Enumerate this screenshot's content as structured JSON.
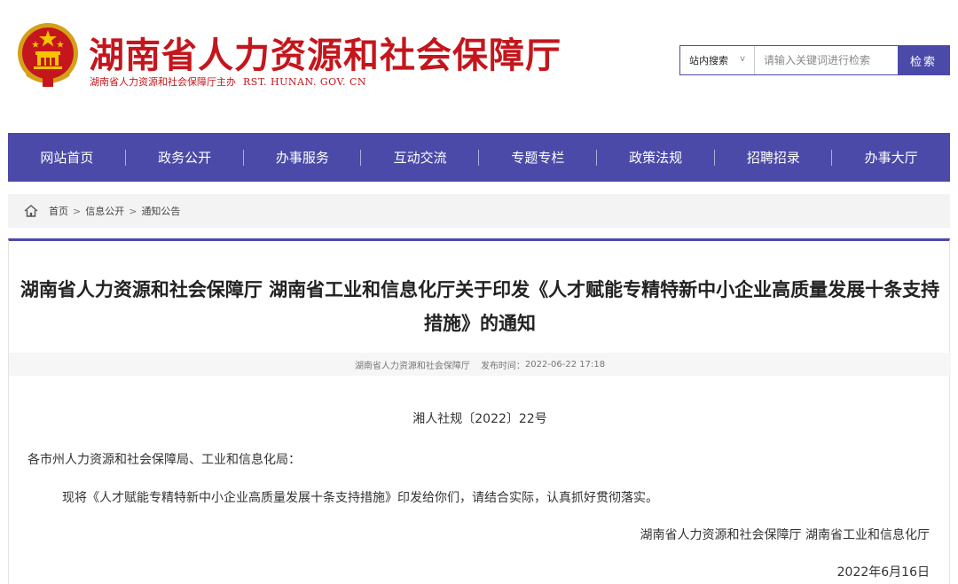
{
  "header": {
    "title": "湖南省人力资源和社会保障厅",
    "subtitle": "湖南省人力资源和社会保障厅主办",
    "domain": "RST. HUNAN. GOV. CN"
  },
  "search": {
    "scope_label": "站内搜索",
    "placeholder": "请输入关键词进行检索",
    "button_label": "检索"
  },
  "nav": {
    "items": [
      "网站首页",
      "政务公开",
      "办事服务",
      "互动交流",
      "专题专栏",
      "政策法规",
      "招聘招录",
      "办事大厅"
    ]
  },
  "breadcrumb": {
    "items": [
      "首页",
      "信息公开",
      "通知公告"
    ]
  },
  "article": {
    "title": "湖南省人力资源和社会保障厅 湖南省工业和信息化厅关于印发《人才赋能专精特新中小企业高质量发展十条支持措施》的通知",
    "source": "湖南省人力资源和社会保障厅",
    "publish_time_label": "发布时间：",
    "publish_time": "2022-06-22 17:18",
    "doc_number": "湘人社规〔2022〕22号",
    "salutation": "各市州人力资源和社会保障局、工业和信息化局：",
    "body": "现将《人才赋能专精特新中小企业高质量发展十条支持措施》印发给你们，请结合实际，认真抓好贯彻落实。",
    "signature": "湖南省人力资源和社会保障厅 湖南省工业和信息化厅",
    "date": "2022年6月16日"
  },
  "colors": {
    "brand_red": "#c4161c",
    "nav_purple": "#4b4aa8"
  }
}
